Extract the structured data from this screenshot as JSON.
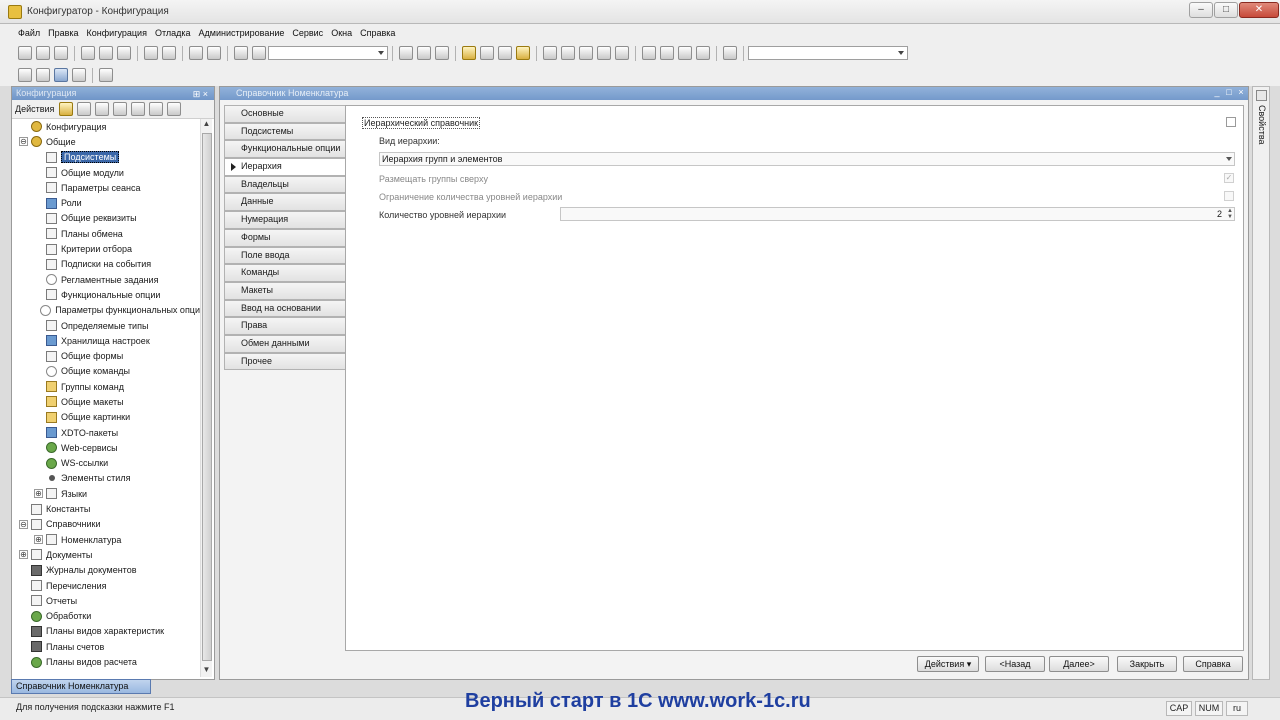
{
  "window": {
    "title": "Конфигуратор - Конфигурация"
  },
  "menu": [
    "Файл",
    "Правка",
    "Конфигурация",
    "Отладка",
    "Администрирование",
    "Сервис",
    "Окна",
    "Справка"
  ],
  "left_panel": {
    "title": "Конфигурация",
    "actions_label": "Действия",
    "tree": [
      {
        "label": "Конфигурация",
        "level": 0,
        "icon": "config-icon",
        "expander": ""
      },
      {
        "label": "Общие",
        "level": 0,
        "icon": "common-icon",
        "expander": "⊖"
      },
      {
        "label": "Подсистемы",
        "level": 1,
        "icon": "subsystems-icon",
        "selected": true
      },
      {
        "label": "Общие модули",
        "level": 1,
        "icon": "module-icon"
      },
      {
        "label": "Параметры сеанса",
        "level": 1,
        "icon": "session-params-icon"
      },
      {
        "label": "Роли",
        "level": 1,
        "icon": "role-icon"
      },
      {
        "label": "Общие реквизиты",
        "level": 1,
        "icon": "attribute-icon"
      },
      {
        "label": "Планы обмена",
        "level": 1,
        "icon": "exchange-plan-icon"
      },
      {
        "label": "Критерии отбора",
        "level": 1,
        "icon": "filter-icon"
      },
      {
        "label": "Подписки на события",
        "level": 1,
        "icon": "subscription-icon"
      },
      {
        "label": "Регламентные задания",
        "level": 1,
        "icon": "clock-icon"
      },
      {
        "label": "Функциональные опции",
        "level": 1,
        "icon": "option-icon"
      },
      {
        "label": "Параметры функциональных опци",
        "level": 1,
        "icon": "option-params-icon"
      },
      {
        "label": "Определяемые типы",
        "level": 1,
        "icon": "type-icon"
      },
      {
        "label": "Хранилища настроек",
        "level": 1,
        "icon": "storage-icon"
      },
      {
        "label": "Общие формы",
        "level": 1,
        "icon": "form-icon"
      },
      {
        "label": "Общие команды",
        "level": 1,
        "icon": "command-icon"
      },
      {
        "label": "Группы команд",
        "level": 1,
        "icon": "command-group-icon"
      },
      {
        "label": "Общие макеты",
        "level": 1,
        "icon": "template-icon"
      },
      {
        "label": "Общие картинки",
        "level": 1,
        "icon": "picture-icon"
      },
      {
        "label": "XDTO-пакеты",
        "level": 1,
        "icon": "xdto-icon"
      },
      {
        "label": "Web-сервисы",
        "level": 1,
        "icon": "web-service-icon"
      },
      {
        "label": "WS-ссылки",
        "level": 1,
        "icon": "ws-link-icon"
      },
      {
        "label": "Элементы стиля",
        "level": 1,
        "icon": "style-icon"
      },
      {
        "label": "Языки",
        "level": 1,
        "icon": "language-icon",
        "expander": "⊕"
      },
      {
        "label": "Константы",
        "level": 0,
        "icon": "constant-icon"
      },
      {
        "label": "Справочники",
        "level": 0,
        "icon": "catalog-icon",
        "expander": "⊖"
      },
      {
        "label": "Номенклатура",
        "level": 1,
        "icon": "catalog-item-icon",
        "expander": "⊕"
      },
      {
        "label": "Документы",
        "level": 0,
        "icon": "document-icon",
        "expander": "⊕"
      },
      {
        "label": "Журналы документов",
        "level": 0,
        "icon": "journal-icon"
      },
      {
        "label": "Перечисления",
        "level": 0,
        "icon": "enum-icon"
      },
      {
        "label": "Отчеты",
        "level": 0,
        "icon": "report-icon"
      },
      {
        "label": "Обработки",
        "level": 0,
        "icon": "processing-icon"
      },
      {
        "label": "Планы видов характеристик",
        "level": 0,
        "icon": "chart-types-icon"
      },
      {
        "label": "Планы счетов",
        "level": 0,
        "icon": "accounts-icon"
      },
      {
        "label": "Планы видов расчета",
        "level": 0,
        "icon": "calc-types-icon"
      }
    ]
  },
  "taskbar_tab": "Справочник Номенклатура",
  "editor": {
    "title": "Справочник Номенклатура",
    "tabs": [
      "Основные",
      "Подсистемы",
      "Функциональные опции",
      "Иерархия",
      "Владельцы",
      "Данные",
      "Нумерация",
      "Формы",
      "Поле ввода",
      "Команды",
      "Макеты",
      "Ввод на основании",
      "Права",
      "Обмен данными",
      "Прочее"
    ],
    "active_tab": "Иерархия",
    "hierarchical_label": "Иерархический справочник",
    "hierarchy_type_label": "Вид иерархии:",
    "hierarchy_type_value": "Иерархия групп и элементов",
    "groups_on_top_label": "Размещать группы сверху",
    "limit_levels_label": "Ограничение количества уровней иерархии",
    "levels_count_label": "Количество уровней иерархии",
    "levels_count_value": "2",
    "buttons": {
      "actions": "Действия",
      "back": "<Назад",
      "next": "Далее>",
      "close": "Закрыть",
      "help": "Справка"
    }
  },
  "properties_panel_label": "Свойства",
  "status": {
    "hint": "Для получения подсказки нажмите F1",
    "caption": "Верный старт в 1С www.work-1c.ru",
    "cap": "CAP",
    "num": "NUM",
    "lang": "ru"
  }
}
